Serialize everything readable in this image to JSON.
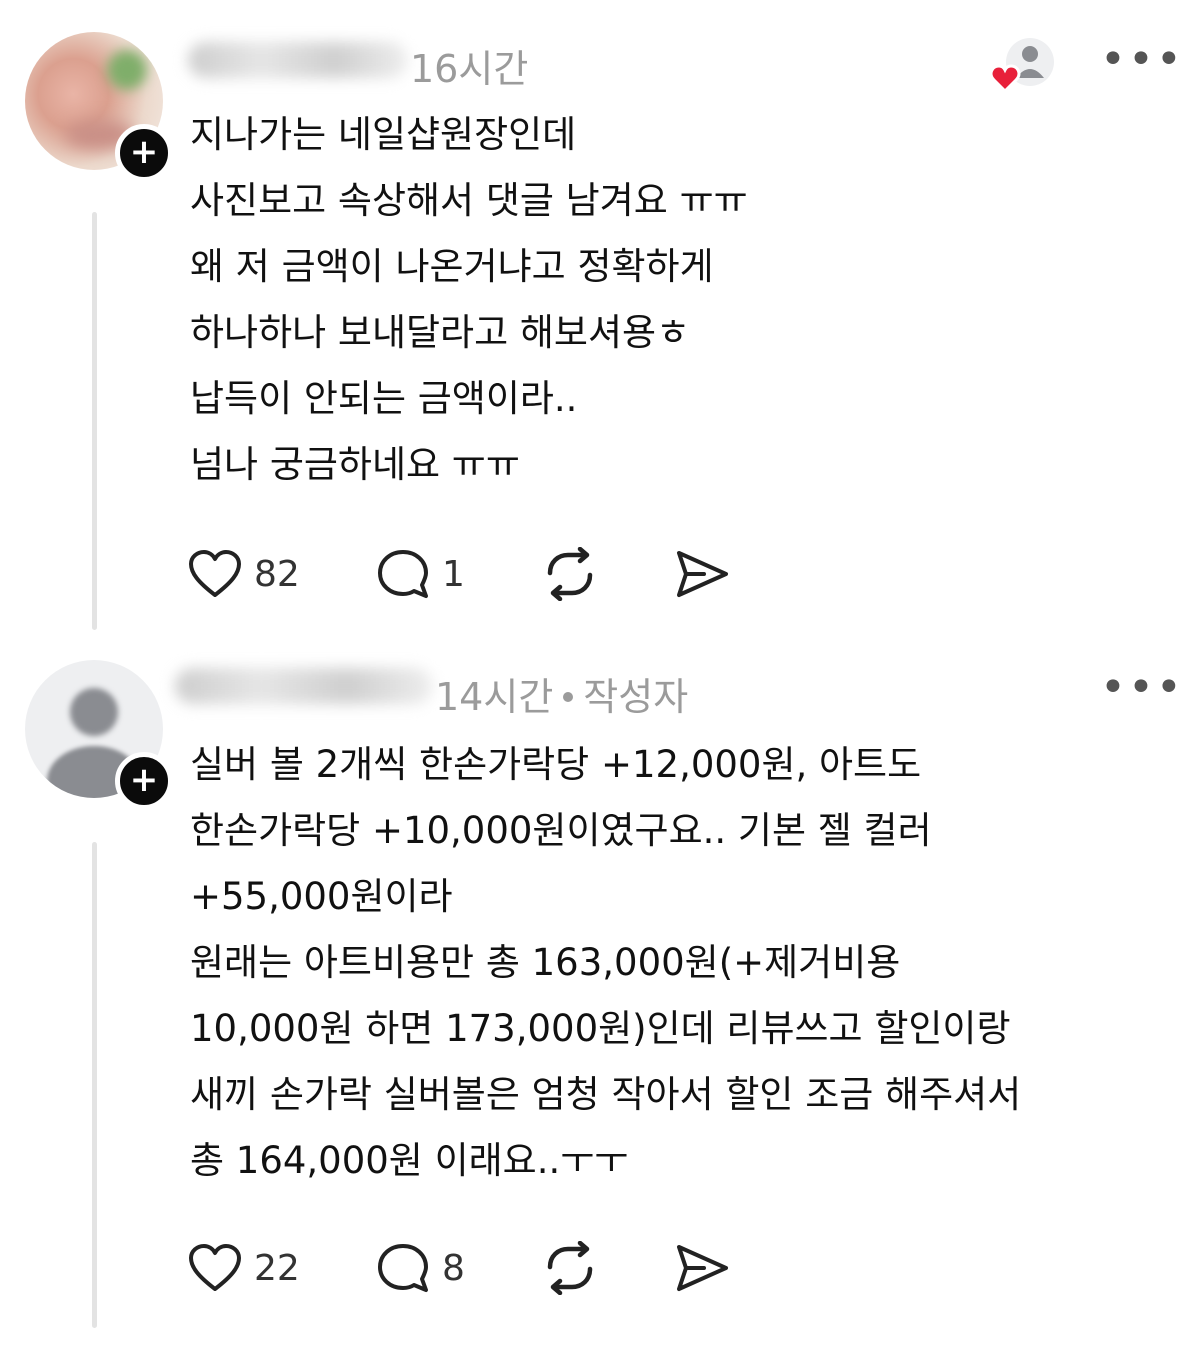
{
  "posts": [
    {
      "time": "16시간",
      "author_tag": "",
      "lines": [
        "지나가는 네일샵원장인데",
        "사진보고 속상해서 댓글 남겨요 ㅠㅠ",
        "왜 저 금액이 나온거냐고 정확하게",
        "하나하나 보내달라고 해보셔용ㅎ",
        "납득이 안되는 금액이라..",
        "넘나 궁금하네요 ㅠㅠ"
      ],
      "likes": "82",
      "replies": "1"
    },
    {
      "time": "14시간",
      "author_tag": "작성자",
      "lines": [
        "실버 볼 2개씩 한손가락당 +12,000원, 아트도",
        "한손가락당 +10,000원이였구요.. 기본 젤 컬러",
        "+55,000원이라",
        "원래는 아트비용만 총 163,000원(+제거비용",
        "10,000원 하면 173,000원)인데 리뷰쓰고 할인이랑",
        "새끼 손가락 실버볼은 엄청 작아서 할인 조금 해주셔서",
        "총 164,000원 이래요..ㅜㅜ"
      ],
      "likes": "22",
      "replies": "8"
    }
  ],
  "icons": {
    "more": "more-horizontal-icon",
    "like": "heart-icon",
    "reply": "comment-icon",
    "repost": "repost-icon",
    "share": "send-icon",
    "follow": "plus-icon",
    "activity": "liked-by-author-icon"
  },
  "colors": {
    "text": "#111111",
    "meta": "#9b9b9b",
    "heart": "#e8203a",
    "badge": "#0b0b0b"
  }
}
